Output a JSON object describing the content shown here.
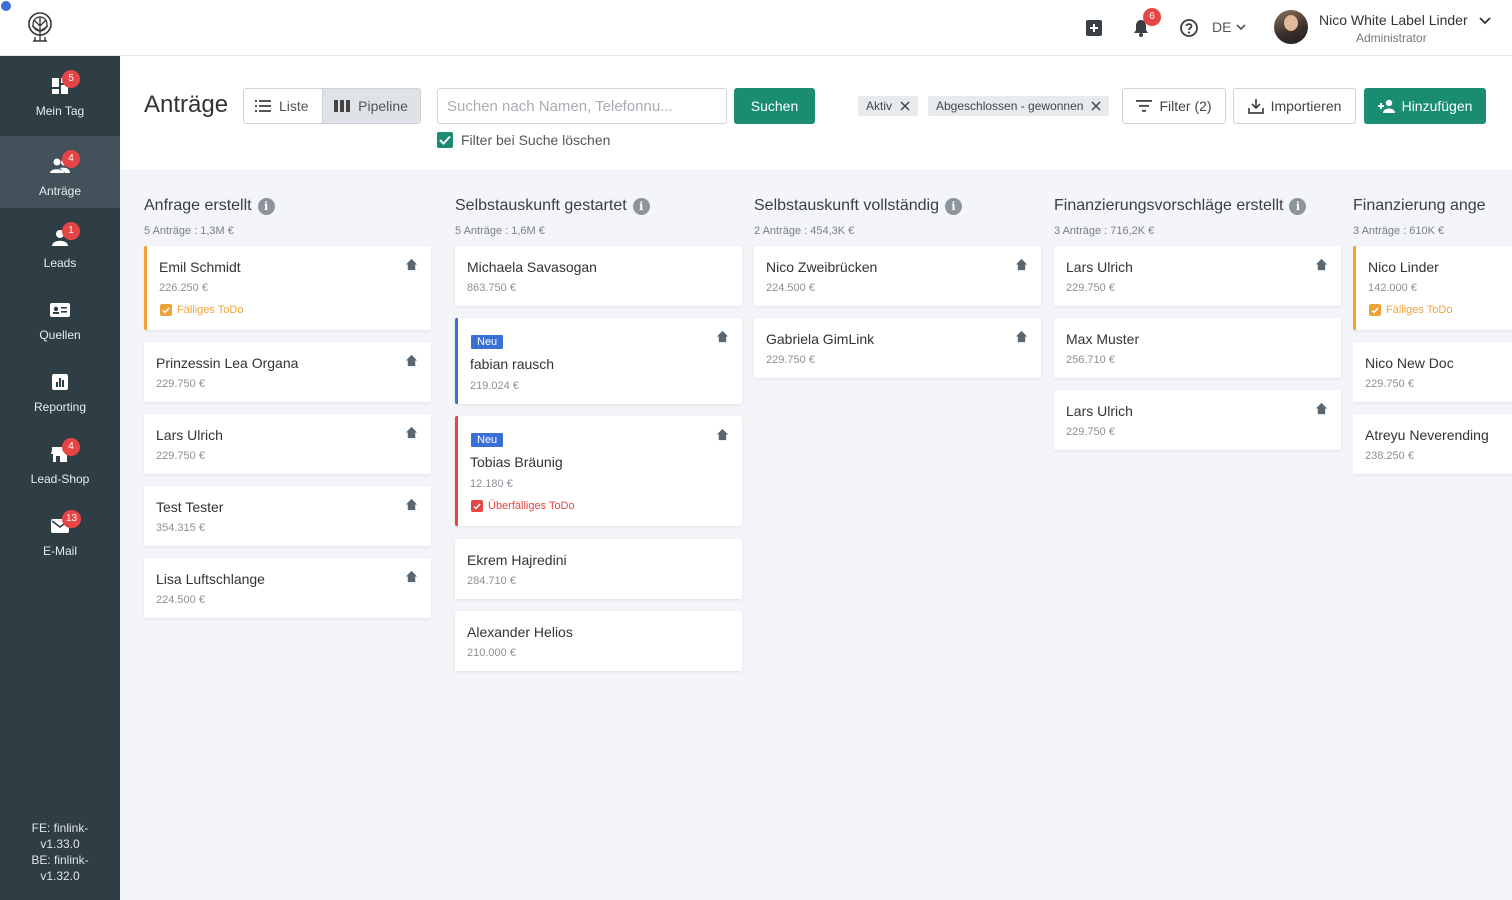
{
  "topbar": {
    "logo_icon": "tree-logo-icon",
    "add_icon": "plus-square-icon",
    "notifications": {
      "icon": "bell-icon",
      "count": "6"
    },
    "help_icon": "help-circle-icon",
    "language": "DE",
    "user": {
      "name": "Nico White Label Linder",
      "role": "Administrator"
    }
  },
  "sidebar": {
    "items": [
      {
        "label": "Mein Tag",
        "icon": "dashboard-icon",
        "badge": "5",
        "active": false
      },
      {
        "label": "Anträge",
        "icon": "users-icon",
        "badge": "4",
        "active": true
      },
      {
        "label": "Leads",
        "icon": "person-icon",
        "badge": "1",
        "active": false
      },
      {
        "label": "Quellen",
        "icon": "id-card-icon",
        "badge": "",
        "active": false
      },
      {
        "label": "Reporting",
        "icon": "bar-chart-icon",
        "badge": "",
        "active": false
      },
      {
        "label": "Lead-Shop",
        "icon": "store-icon",
        "badge": "4",
        "active": false
      },
      {
        "label": "E-Mail",
        "icon": "mail-icon",
        "badge": "13",
        "active": false
      }
    ],
    "version_lines": [
      "FE: finlink-",
      "v1.33.0",
      "BE: finlink-",
      "v1.32.0"
    ]
  },
  "header": {
    "title": "Anträge",
    "view_list": "Liste",
    "view_pipeline": "Pipeline",
    "search_placeholder": "Suchen nach Namen, Telefonnu...",
    "search_button": "Suchen",
    "clear_filter_label": "Filter bei Suche löschen",
    "chips": [
      "Aktiv",
      "Abgeschlossen - gewonnen"
    ],
    "filter_button": "Filter (2)",
    "import_button": "Importieren",
    "add_button": "Hinzufügen"
  },
  "colors": {
    "accent": "#1a8c72",
    "sidebar": "#2f3d45",
    "badge": "#e54545",
    "new": "#3b6fd8",
    "todo": "#f0a23a"
  },
  "columns": [
    {
      "title": "Anfrage erstellt",
      "summary": "5 Anträge : 1,3M €",
      "cards": [
        {
          "name": "Emil Schmidt",
          "amount": "226.250 €",
          "home": true,
          "todo": "Fälliges ToDo",
          "status": "todo"
        },
        {
          "name": "Prinzessin Lea Organa",
          "amount": "229.750 €",
          "home": true
        },
        {
          "name": "Lars Ulrich",
          "amount": "229.750 €",
          "home": true
        },
        {
          "name": "Test Tester",
          "amount": "354.315 €",
          "home": true
        },
        {
          "name": "Lisa Luftschlange",
          "amount": "224.500 €",
          "home": true
        }
      ]
    },
    {
      "title": "Selbstauskunft gestartet",
      "summary": "5 Anträge : 1,6M €",
      "cards": [
        {
          "name": "Michaela Savasogan",
          "amount": "863.750 €",
          "home": false
        },
        {
          "name": "fabian rausch",
          "amount": "219.024 €",
          "home": true,
          "badge": "Neu",
          "status": "neu"
        },
        {
          "name": "Tobias Bräunig",
          "amount": "12.180 €",
          "home": true,
          "badge": "Neu",
          "todo": "Überfälliges ToDo",
          "status": "overdue"
        },
        {
          "name": "Ekrem Hajredini",
          "amount": "284.710 €",
          "home": false
        },
        {
          "name": "Alexander Helios",
          "amount": "210.000 €",
          "home": false
        }
      ]
    },
    {
      "title": "Selbstauskunft vollständig",
      "summary": "2 Anträge : 454,3K €",
      "cards": [
        {
          "name": "Nico Zweibrücken",
          "amount": "224.500 €",
          "home": true
        },
        {
          "name": "Gabriela GimLink",
          "amount": "229.750 €",
          "home": true
        }
      ]
    },
    {
      "title": "Finanzierungsvorschläge erstellt",
      "summary": "3 Anträge : 716,2K €",
      "cards": [
        {
          "name": "Lars Ulrich",
          "amount": "229.750 €",
          "home": true
        },
        {
          "name": "Max Muster",
          "amount": "256.710 €",
          "home": false
        },
        {
          "name": "Lars Ulrich",
          "amount": "229.750 €",
          "home": true
        }
      ]
    },
    {
      "title": "Finanzierung ange",
      "summary": "3 Anträge : 610K €",
      "cards": [
        {
          "name": "Nico Linder",
          "amount": "142.000 €",
          "home": false,
          "todo": "Fälliges ToDo",
          "status": "todo"
        },
        {
          "name": "Nico New Doc",
          "amount": "229.750 €",
          "home": false
        },
        {
          "name": "Atreyu Neverending",
          "amount": "238.250 €",
          "home": false
        }
      ]
    }
  ]
}
